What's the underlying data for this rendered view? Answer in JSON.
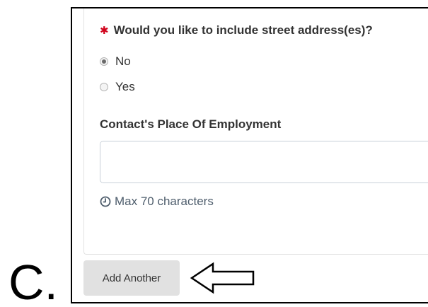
{
  "step_letter": "C.",
  "form": {
    "question": {
      "required_mark": "✱",
      "text": "Would you like to include street address(es)?"
    },
    "options": [
      {
        "label": "No",
        "selected": true
      },
      {
        "label": "Yes",
        "selected": false
      }
    ],
    "employment": {
      "label": "Contact's Place Of Employment",
      "value": "",
      "hint": "Max 70 characters",
      "hint_icon": "clock-icon"
    }
  },
  "actions": {
    "add_another_label": "Add Another"
  },
  "annotation": {
    "icon": "left-arrow-icon"
  },
  "colors": {
    "required": "#d0021b",
    "button_bg": "#e1e1e1",
    "hint_text": "#4e5d6c",
    "input_border": "#c8d0d8"
  }
}
